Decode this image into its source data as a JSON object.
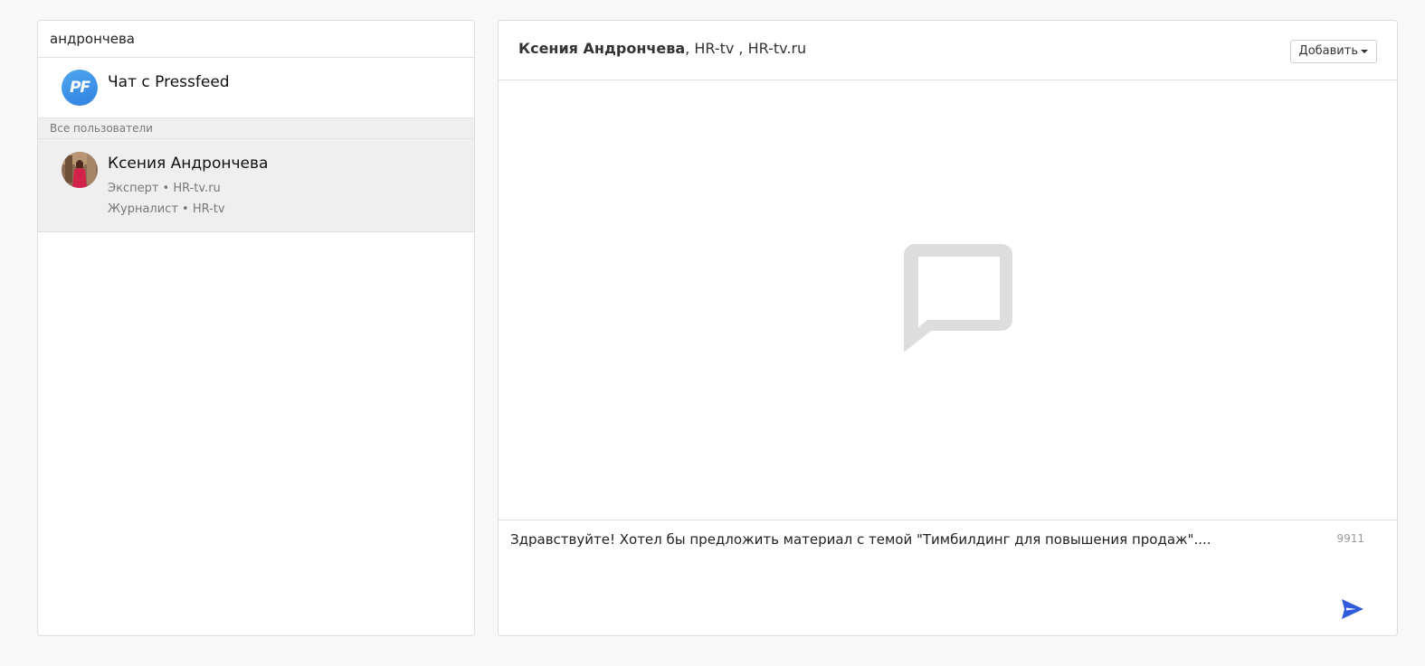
{
  "sidebar": {
    "search": {
      "value": "андрончева",
      "placeholder": ""
    },
    "pressfeed_chat": {
      "logo_text": "PF",
      "label": "Чат с Pressfeed"
    },
    "section_label": "Все пользователи",
    "users": [
      {
        "name": "Ксения Андрончева",
        "roles": [
          "Эксперт • HR-tv.ru",
          "Журналист • HR-tv"
        ],
        "selected": true
      }
    ]
  },
  "chat": {
    "header": {
      "name": "Ксения Андрончева",
      "affiliation": ", HR-tv , HR-tv.ru"
    },
    "add_button": "Добавить",
    "empty_state_icon": "speech-bubble-icon",
    "composer": {
      "message": "Здравствуйте! Хотел бы предложить материал с темой \"Тимбилдинг для повышения продаж\"....",
      "char_count": "9911",
      "send_icon": "send-icon"
    }
  },
  "colors": {
    "accent": "#2f5cd8",
    "pf_logo": "#3a8fe6",
    "background": "#f8f8f8",
    "selected_row": "#efefef",
    "empty_icon": "#dddddd"
  }
}
